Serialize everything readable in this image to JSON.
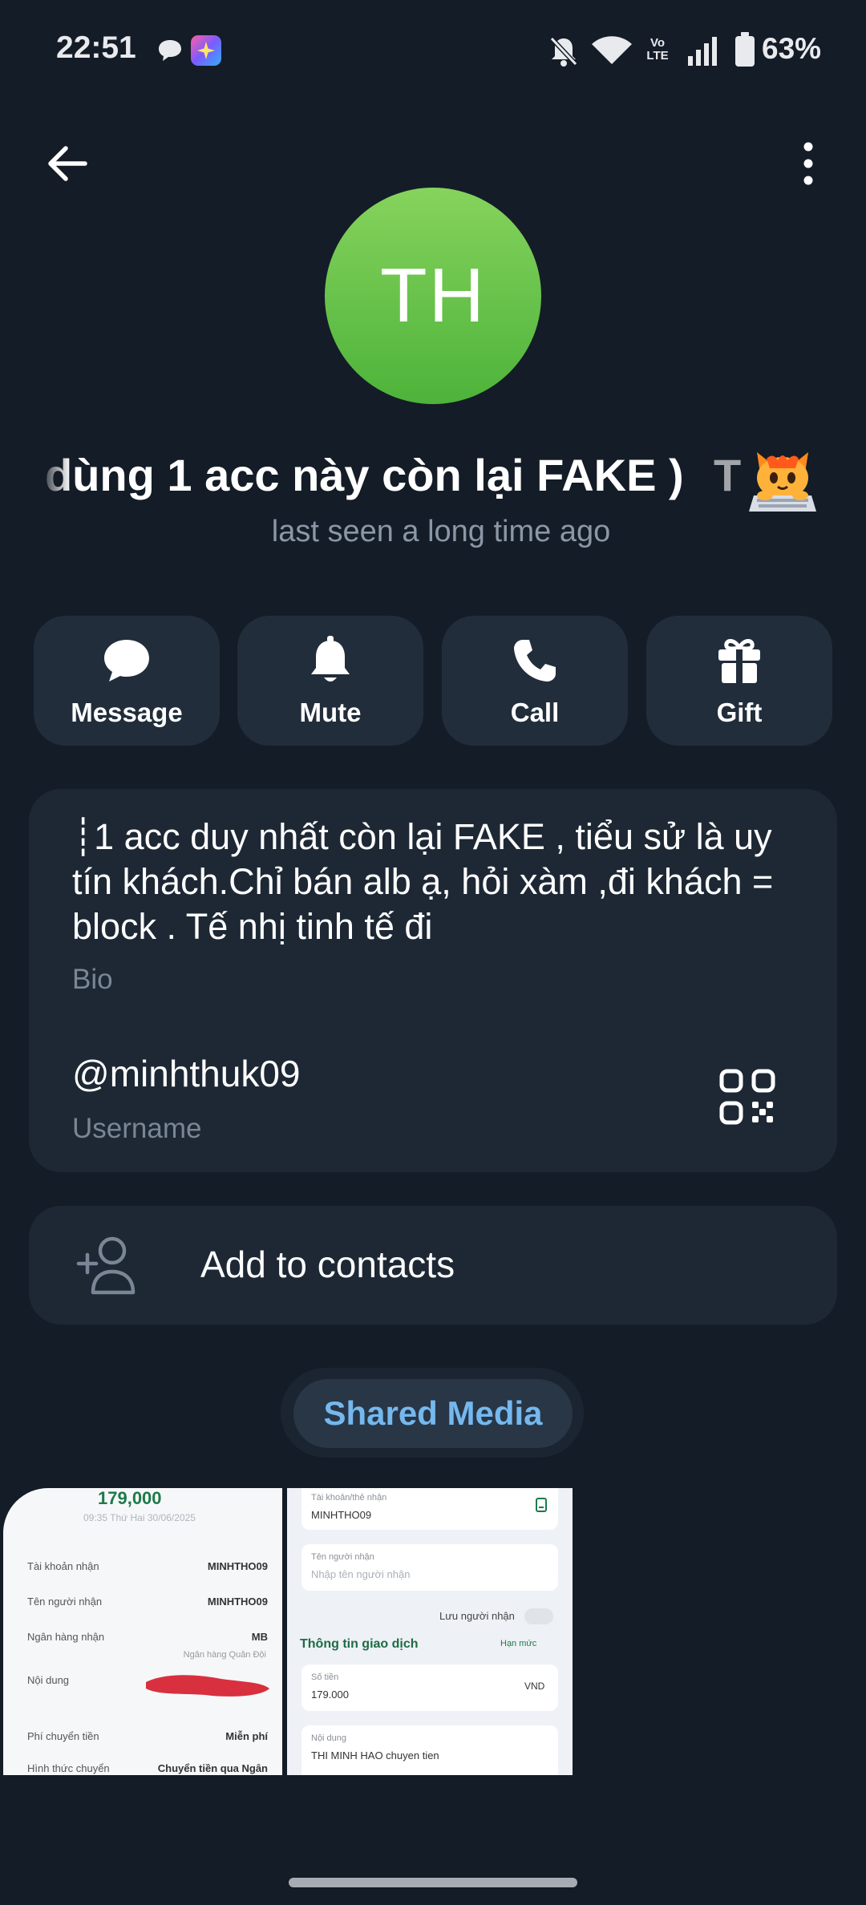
{
  "status_bar": {
    "time": "22:51",
    "network": "Vo LTE",
    "battery": "63%"
  },
  "profile": {
    "initials": "TH",
    "avatar_colors": [
      "#86d35d",
      "#4db33a"
    ],
    "name_visible": "dùng 1 acc này còn lại FAKE )",
    "name_tail": "T",
    "emoji": "typing-cat-emoji",
    "last_seen": "last seen a long time ago"
  },
  "actions": [
    {
      "label": "Message",
      "icon": "chat-bubble-icon"
    },
    {
      "label": "Mute",
      "icon": "bell-icon"
    },
    {
      "label": "Call",
      "icon": "phone-icon"
    },
    {
      "label": "Gift",
      "icon": "gift-icon"
    }
  ],
  "info": {
    "bio": "┊1 acc duy nhất còn lại FAKE , tiểu sử là uy tín khách.Chỉ bán alb ạ, hỏi xàm ,đi khách = block . Tế nhị tinh tế đi",
    "bio_label": "Bio",
    "username": "@minhthuk09",
    "username_label": "Username"
  },
  "contact": {
    "label": "Add to contacts"
  },
  "shared_media": {
    "tab_label": "Shared Media",
    "accent": "#74b8ee",
    "thumb1": {
      "amount": "179,000",
      "date": "09:35 Thứ Hai 30/06/2025",
      "rows": [
        {
          "k": "Tài khoản nhận",
          "v": "MINHTHO09"
        },
        {
          "k": "Tên người nhận",
          "v": "MINHTHO09"
        },
        {
          "k": "Ngân hàng nhận",
          "v": "MB"
        },
        {
          "k": "Nội dung",
          "v": ""
        },
        {
          "k": "Phí chuyển tiền",
          "v": "Miễn phí"
        },
        {
          "k": "Hình thức chuyển",
          "v": "Chuyển tiền qua Ngân"
        }
      ],
      "bank_sub": "Ngân hàng Quân Đội"
    },
    "thumb2": {
      "account_label": "Tài khoản/thẻ nhận",
      "account_value": "MINHTHO09",
      "name_label": "Tên người nhận",
      "name_placeholder": "Nhập tên người nhận",
      "save_label": "Lưu người nhận",
      "section": "Thông tin giao dịch",
      "limit": "Hạn mức",
      "amount_label": "Số tiền",
      "amount_value": "179.000",
      "currency": "VND",
      "content_label": "Nội dung",
      "content_value": "THI MINH HAO chuyen tien"
    }
  }
}
